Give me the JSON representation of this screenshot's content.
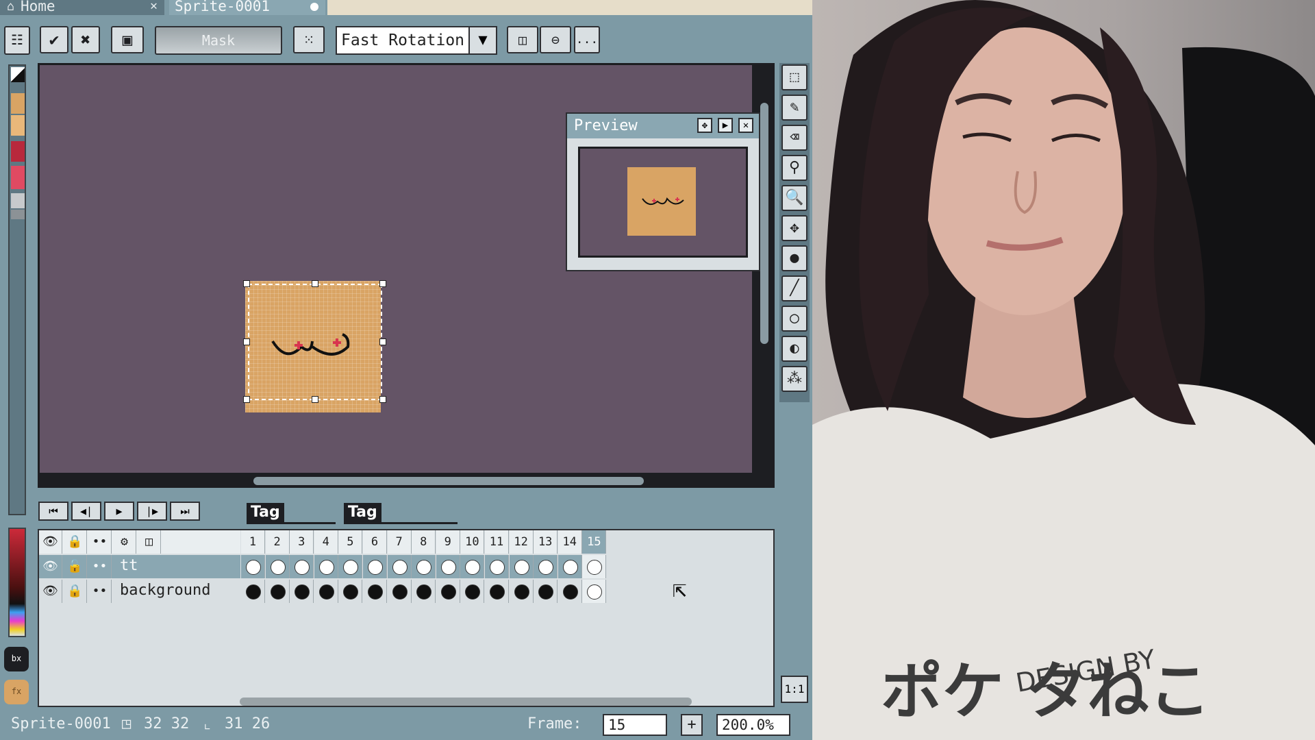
{
  "tabs": {
    "home": "Home",
    "sprite": "Sprite-0001"
  },
  "toolbar": {
    "mask_label": "Mask",
    "rotation_value": "Fast Rotation",
    "more_label": "..."
  },
  "preview": {
    "title": "Preview"
  },
  "timeline": {
    "tags": [
      "Tag",
      "Tag"
    ],
    "frames": [
      "1",
      "2",
      "3",
      "4",
      "5",
      "6",
      "7",
      "8",
      "9",
      "10",
      "11",
      "12",
      "13",
      "14",
      "15"
    ],
    "layers": [
      {
        "name": "tt",
        "cel_color": "#ffffff"
      },
      {
        "name": "background",
        "cel_color": "#111111"
      }
    ]
  },
  "status": {
    "sprite_name": "Sprite-0001",
    "size": "32 32",
    "position": "31 26",
    "frame_label": "Frame:",
    "frame_value": "15",
    "zoom_value": "200.0%"
  },
  "one_to_one": "1:1",
  "colors": {
    "canvas_bg": "#645466",
    "sprite_fill": "#d9a464",
    "ui_panel": "#7d9aa5",
    "layer_highlight": "#8aa7b2"
  },
  "webcam": {
    "shirt_text": "ポケ  タねこ",
    "shirt_sub": "DESIGN BY"
  }
}
